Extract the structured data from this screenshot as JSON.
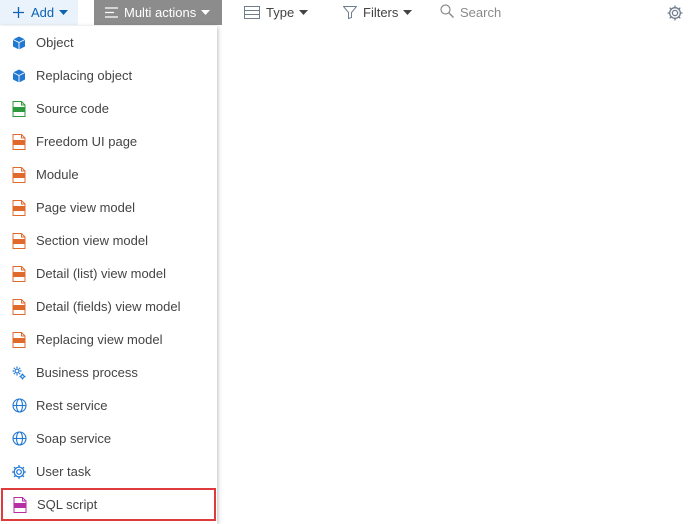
{
  "toolbar": {
    "add_label": "Add",
    "multi_label": "Multi actions",
    "type_label": "Type",
    "filters_label": "Filters",
    "search_placeholder": "Search"
  },
  "colors": {
    "accent": "#0d63b3",
    "multi_bg": "#8c8c8c",
    "add_bg": "#eaf2fb",
    "highlight": "#e03b3b"
  },
  "menu": {
    "items": [
      {
        "label": "Object",
        "icon": "cube-icon"
      },
      {
        "label": "Replacing object",
        "icon": "cube-icon"
      },
      {
        "label": "Source code",
        "icon": "csharp-file-icon"
      },
      {
        "label": "Freedom UI page",
        "icon": "js-file-icon"
      },
      {
        "label": "Module",
        "icon": "js-file-icon"
      },
      {
        "label": "Page view model",
        "icon": "js-file-icon"
      },
      {
        "label": "Section view model",
        "icon": "js-file-icon"
      },
      {
        "label": "Detail (list) view model",
        "icon": "js-file-icon"
      },
      {
        "label": "Detail (fields) view model",
        "icon": "js-file-icon"
      },
      {
        "label": "Replacing view model",
        "icon": "js-file-icon"
      },
      {
        "label": "Business process",
        "icon": "process-icon"
      },
      {
        "label": "Rest service",
        "icon": "globe-icon"
      },
      {
        "label": "Soap service",
        "icon": "globe-icon"
      },
      {
        "label": "User task",
        "icon": "gear-icon"
      },
      {
        "label": "SQL script",
        "icon": "sql-file-icon"
      }
    ]
  }
}
